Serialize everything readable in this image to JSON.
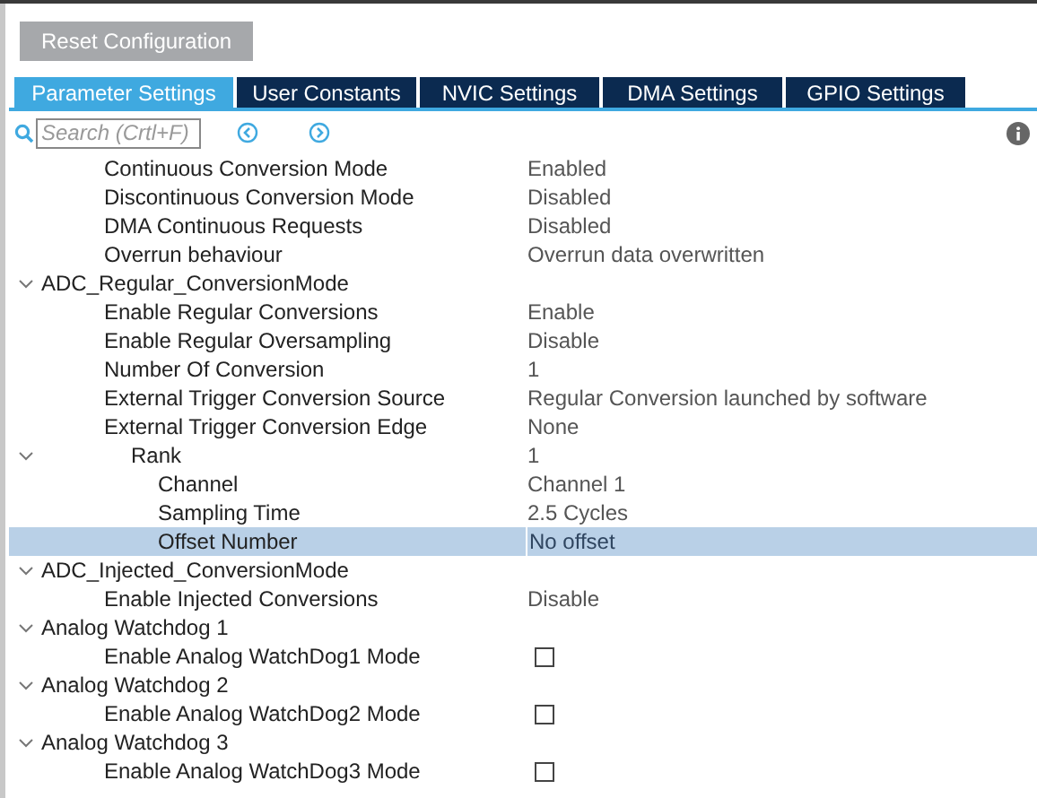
{
  "reset_button": "Reset Configuration",
  "tabs": [
    {
      "label": "Parameter Settings",
      "selected": true
    },
    {
      "label": "User Constants",
      "selected": false
    },
    {
      "label": "NVIC Settings",
      "selected": false
    },
    {
      "label": "DMA Settings",
      "selected": false
    },
    {
      "label": "GPIO Settings",
      "selected": false
    }
  ],
  "search": {
    "placeholder": "Search (Crtl+F)"
  },
  "tree": [
    {
      "children": [
        {
          "kind": "param",
          "label": "Continuous Conversion Mode",
          "value": "Enabled",
          "selected": false
        },
        {
          "kind": "param",
          "label": "Discontinuous Conversion Mode",
          "value": "Disabled",
          "selected": false
        },
        {
          "kind": "param",
          "label": "DMA Continuous Requests",
          "value": "Disabled",
          "selected": false
        },
        {
          "kind": "param",
          "label": "Overrun behaviour",
          "value": "Overrun data overwritten",
          "selected": false
        }
      ]
    },
    {
      "kind": "group",
      "label": "ADC_Regular_ConversionMode",
      "expanded": true,
      "selected": false,
      "children": [
        {
          "kind": "param",
          "label": "Enable Regular Conversions",
          "value": "Enable",
          "selected": false
        },
        {
          "kind": "param",
          "label": "Enable Regular Oversampling",
          "value": "Disable",
          "selected": false
        },
        {
          "kind": "param",
          "label": "Number Of Conversion",
          "value": "1",
          "selected": false
        },
        {
          "kind": "param",
          "label": "External Trigger Conversion Source",
          "value": "Regular Conversion launched by software",
          "selected": false
        },
        {
          "kind": "param",
          "label": "External Trigger Conversion Edge",
          "value": "None",
          "selected": false
        },
        {
          "kind": "group",
          "label": "Rank",
          "value": "1",
          "expanded": true,
          "selected": false,
          "children": [
            {
              "kind": "param",
              "label": "Channel",
              "value": "Channel 1",
              "selected": false
            },
            {
              "kind": "param",
              "label": "Sampling Time",
              "value": "2.5 Cycles",
              "selected": false
            },
            {
              "kind": "param",
              "label": "Offset Number",
              "value": "No offset",
              "selected": true
            }
          ]
        }
      ]
    },
    {
      "kind": "group",
      "label": "ADC_Injected_ConversionMode",
      "expanded": true,
      "selected": false,
      "children": [
        {
          "kind": "param",
          "label": "Enable Injected Conversions",
          "value": "Disable",
          "selected": false
        }
      ]
    },
    {
      "kind": "group",
      "label": "Analog Watchdog 1",
      "expanded": true,
      "selected": false,
      "children": [
        {
          "kind": "check",
          "label": "Enable Analog WatchDog1 Mode",
          "checked": false,
          "selected": false
        }
      ]
    },
    {
      "kind": "group",
      "label": "Analog Watchdog 2",
      "expanded": true,
      "selected": false,
      "children": [
        {
          "kind": "check",
          "label": "Enable Analog WatchDog2 Mode",
          "checked": false,
          "selected": false
        }
      ]
    },
    {
      "kind": "group",
      "label": "Analog Watchdog 3",
      "expanded": true,
      "selected": false,
      "children": [
        {
          "kind": "check",
          "label": "Enable Analog WatchDog3 Mode",
          "checked": false,
          "selected": false
        }
      ]
    }
  ]
}
